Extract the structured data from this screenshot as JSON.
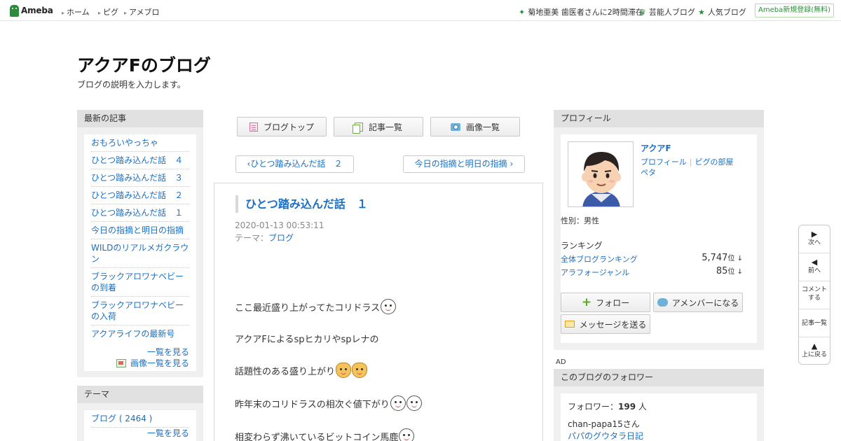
{
  "topbar": {
    "logo": "Ameba",
    "nav": [
      "ホーム",
      "ピグ",
      "アメブロ"
    ],
    "news": "菊地亜美 歯医者さんに2時間滞在",
    "celeb": "芸能人ブログ",
    "popular": "人気ブログ",
    "signup": "Ameba新規登録(無料)"
  },
  "blog": {
    "title": "アクアFのブログ",
    "description": "ブログの説明を入力します。"
  },
  "latest": {
    "heading": "最新の記事",
    "items": [
      "おもろいやっちゃ",
      "ひとつ踏み込んだ話　４",
      "ひとつ踏み込んだ話　３",
      "ひとつ踏み込んだ話　２",
      "ひとつ踏み込んだ話　１",
      "今日の指摘と明日の指摘",
      "WILDのリアルメガクラウン",
      "ブラックアロワナベビーの到着",
      "ブラックアロワナベビーの入荷",
      "アクアライフの最新号"
    ],
    "see_all": "一覧を見る",
    "see_images": "画像一覧を見る"
  },
  "themes": {
    "heading": "テーマ",
    "items": [
      "ブログ ( 2464 )"
    ],
    "see_all": "一覧を見る"
  },
  "toolbar": {
    "blog_top": "ブログトップ",
    "entry_list": "記事一覧",
    "image_list": "画像一覧"
  },
  "pager": {
    "prev": "ひとつ踏み込んだ話　２",
    "next": "今日の指摘と明日の指摘"
  },
  "entry": {
    "title": "ひとつ踏み込んだ話　１",
    "date": "2020-01-13 00:53:11",
    "theme_label": "テーマ：",
    "theme": "ブログ",
    "lines": [
      "ここ最近盛り上がってたコリドラス",
      "アクアFによるspヒカリやspレナの",
      "話題性のある盛り上がり",
      "昨年末のコリドラスの相次ぐ値下がり",
      "相変わらず沸いているビットコイン馬鹿"
    ]
  },
  "profile": {
    "heading": "プロフィール",
    "name": "アクアF",
    "link_profile": "プロフィール",
    "link_pig": "ピグの部屋",
    "link_peta": "ペタ",
    "gender": "性別：男性",
    "ranking_heading": "ランキング",
    "rank_overall_label": "全体ブログランキング",
    "rank_overall_value": "5,747",
    "rank_genre_label": "アラフォージャンル",
    "rank_genre_value": "85",
    "rank_unit": "位",
    "follow": "フォロー",
    "amember": "アメンバーになる",
    "message": "メッセージを送る"
  },
  "ad": {
    "label": "AD"
  },
  "followers": {
    "heading": "このブログのフォロワー",
    "count_label": "フォロワー：",
    "count": "199",
    "count_unit": "人",
    "follower_name": "chan-papa15さん",
    "follower_blog": "パパのグウタラ日記"
  },
  "sidenav": {
    "next": "次へ",
    "prev": "前へ",
    "comment": "コメントする",
    "list": "記事一覧",
    "top": "上に戻る"
  },
  "colors": {
    "brand": "#2d8c3c",
    "link": "#1a6fc4",
    "panel_head": "#e1e1e1"
  }
}
